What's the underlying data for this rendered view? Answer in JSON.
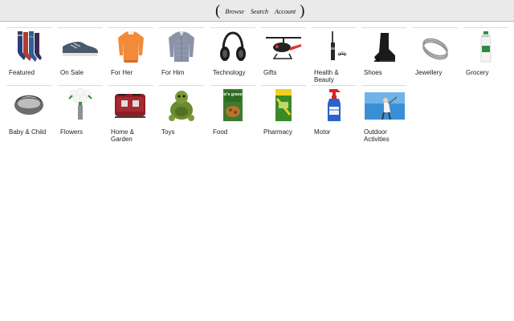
{
  "nav": {
    "browse": "Browse",
    "search": "Search",
    "account": "Account"
  },
  "categories": [
    {
      "label": "Featured",
      "image": "socks"
    },
    {
      "label": "On Sale",
      "image": "shoe"
    },
    {
      "label": "For Her",
      "image": "orange-top"
    },
    {
      "label": "For Him",
      "image": "shirt"
    },
    {
      "label": "Technology",
      "image": "headphones"
    },
    {
      "label": "Gifts",
      "image": "helicopter"
    },
    {
      "label": "Health & Beauty",
      "image": "mascara"
    },
    {
      "label": "Shoes",
      "image": "ankle-boot"
    },
    {
      "label": "Jewellery",
      "image": "bracelet"
    },
    {
      "label": "Grocery",
      "image": "milk-bottle",
      "tag": "4 pints"
    },
    {
      "label": "Baby & Child",
      "image": "carrycot"
    },
    {
      "label": "Flowers",
      "image": "flower-vase"
    },
    {
      "label": "Home & Garden",
      "image": "toaster"
    },
    {
      "label": "Toys",
      "image": "turtle-toy"
    },
    {
      "label": "Food",
      "image": "granola-box",
      "brand": "Lizi's granola"
    },
    {
      "label": "Pharmacy",
      "image": "medicine-box"
    },
    {
      "label": "Motor",
      "image": "spray-bottle"
    },
    {
      "label": "Outdoor Activities",
      "image": "golfer-photo"
    }
  ]
}
